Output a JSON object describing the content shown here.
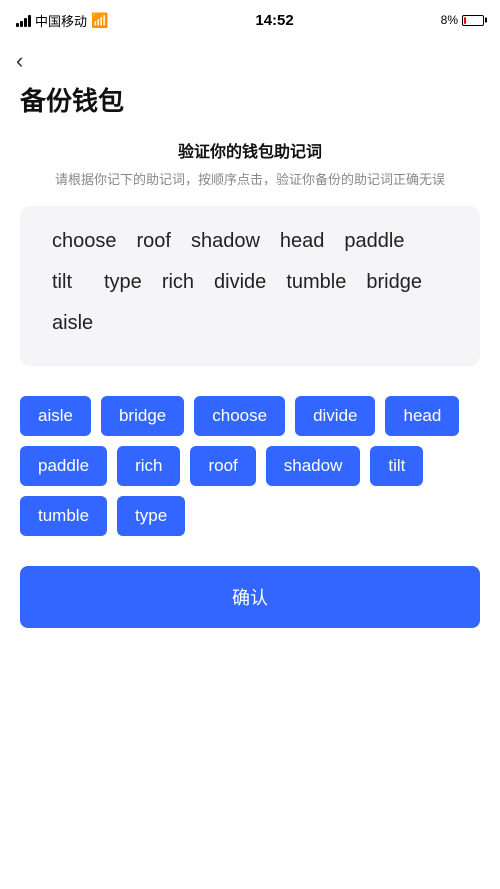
{
  "statusBar": {
    "carrier": "中国移动",
    "time": "14:52",
    "batteryPct": "8%"
  },
  "backLabel": "‹",
  "pageTitle": "备份钱包",
  "sectionHeading": "验证你的钱包助记词",
  "sectionDesc": "请根据你记下的助记词，按顺序点击，验证你备份的助记词正确无误",
  "displayWords": [
    "choose",
    "roof",
    "shadow",
    "head",
    "paddle",
    "tilt",
    "type",
    "rich",
    "divide",
    "tumble",
    "bridge",
    "aisle"
  ],
  "chips": [
    "aisle",
    "bridge",
    "choose",
    "divide",
    "head",
    "paddle",
    "rich",
    "roof",
    "shadow",
    "tilt",
    "tumble",
    "type"
  ],
  "confirmLabel": "确认"
}
